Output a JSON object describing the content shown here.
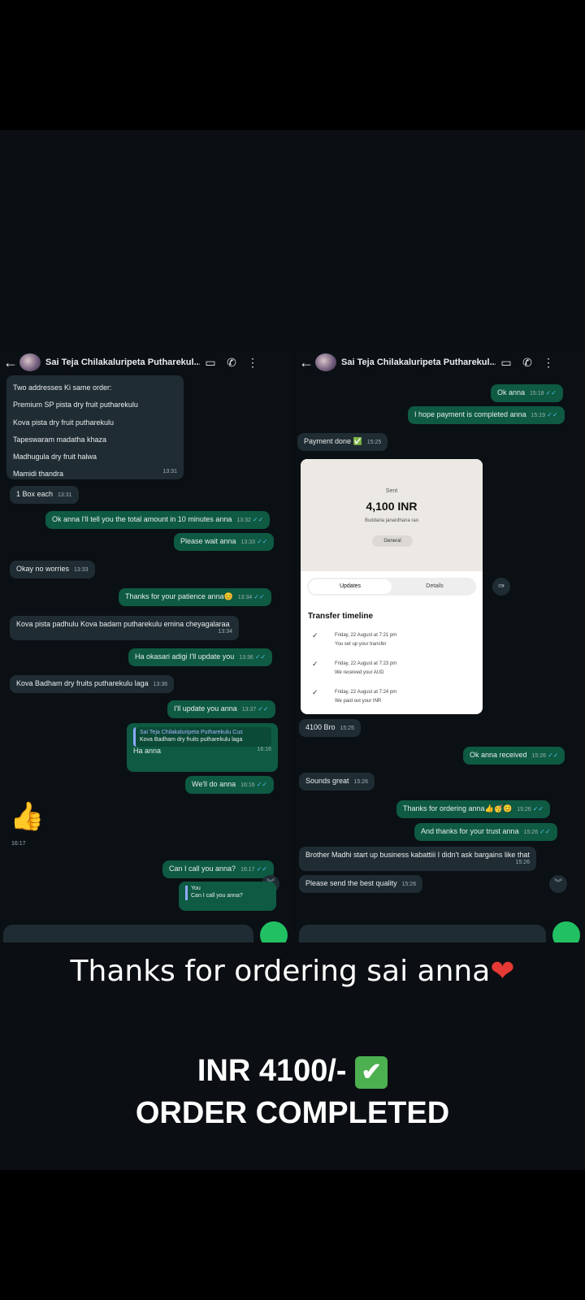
{
  "left_chat": {
    "header": {
      "back": "←",
      "name": "Sai Teja Chilakaluripeta Putharekul...",
      "video": "▭",
      "call": "✆",
      "menu": "⋮"
    },
    "order_lines": [
      "Two addresses Ki same order:",
      "Premium SP pista dry fruit putharekulu",
      "Kova pista dry fruit putharekulu",
      "Tapeswaram madatha khaza",
      "Madhugula dry fruit halwa",
      "Mamidi thandra"
    ],
    "order_time": "13:31",
    "messages": [
      {
        "text": "1 Box each",
        "time": "13:31"
      },
      {
        "text": "Ok anna I'll tell you the total amount in 10 minutes anna",
        "time": "13:32"
      },
      {
        "text": "Please wait anna",
        "time": "13:33"
      },
      {
        "text": "Okay no worries",
        "time": "13:33"
      },
      {
        "text": "Thanks for your patience anna😊",
        "time": "13:34"
      },
      {
        "text": "Kova pista padhulu Kova badam putharekulu emina cheyagalaraa",
        "time": "13:34"
      },
      {
        "text": "Ha okasari adigi I'll update you",
        "time": "13:36"
      },
      {
        "text": "Kova Badham dry fruits putharekulu laga",
        "time": "13:36"
      },
      {
        "text": "I'll update you anna",
        "time": "13:37"
      },
      {
        "quote_name": "Sai Teja Chilakaluripeta Putharekulu Cus",
        "quote_text": "Kova Badham dry fruits putharekulu laga",
        "text": "Ha anna",
        "time": "16:16"
      },
      {
        "text": "We'll do anna",
        "time": "16:16"
      },
      {
        "emoji": "👍",
        "time": "16:17"
      },
      {
        "text": "Can I call you anna?",
        "time": "16:17"
      },
      {
        "reply_you": "You",
        "reply_text": "Can I call you anna?"
      }
    ]
  },
  "right_chat": {
    "header": {
      "back": "←",
      "name": "Sai Teja Chilakaluripeta Putharekul...",
      "video": "▭",
      "call": "✆",
      "menu": "⋮"
    },
    "messages": [
      {
        "text": "Ok anna",
        "time": "15:18"
      },
      {
        "text": "I hope payment is completed anna",
        "time": "15:19"
      },
      {
        "text": "Payment done ✅",
        "time": "15:25"
      },
      {
        "text": "4100 Bro",
        "time": "15:25"
      },
      {
        "text": "Ok anna received",
        "time": "15:26"
      },
      {
        "text": "Sounds great",
        "time": "15:26"
      },
      {
        "text": "Thanks for ordering anna👍🥳😊",
        "time": "15:26"
      },
      {
        "text": "And thanks for your trust anna",
        "time": "15:26"
      },
      {
        "text": "Brother Madhi start up business kabattiii I didn't ask bargains like that",
        "time": "15:26"
      },
      {
        "text": "Please send the best quality",
        "time": "15:26"
      }
    ],
    "receipt": {
      "sent": "Sent",
      "amount": "4,100 INR",
      "recipient": "Buddana janardhana rao",
      "tag": "General",
      "tab_updates": "Updates",
      "tab_details": "Details",
      "timeline_title": "Transfer timeline",
      "steps": [
        {
          "date": "Friday, 22 August at 7:21 pm",
          "desc": "You set up your transfer"
        },
        {
          "date": "Friday, 22 August at 7:23 pm",
          "desc": "We received your AUD"
        },
        {
          "date": "Friday, 22 August at 7:24 pm",
          "desc": "We paid out your INR"
        }
      ],
      "time": "15:25"
    }
  },
  "captions": {
    "line1": "Thanks for ordering sai anna",
    "heart": "❤",
    "line2": "INR 4100/-",
    "check": "✔",
    "line3": "ORDER COMPLETED"
  },
  "ticks": "✓✓",
  "scroll_icon": "︾",
  "forward_icon": "⇛"
}
